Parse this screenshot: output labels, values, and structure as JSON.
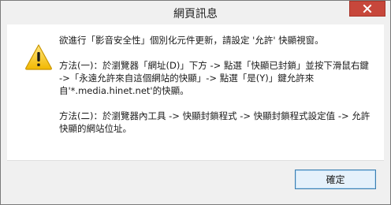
{
  "window": {
    "title": "網頁訊息",
    "close_icon": "close-icon"
  },
  "message": {
    "icon": "warning-icon",
    "line1": "欲進行「影音安全性」個別化元件更新，請設定 '允許' 快顯視窗。",
    "para2": "方法(一)：於瀏覽器「網址(D)」下方 -> 點選「快顯已封鎖」並按下滑鼠右鍵 ->「永遠允許來自這個網站的快顯」-> 點選「是(Y)」鍵允許來自'*.media.hinet.net'的快顯。",
    "para3": "方法(二)：於瀏覽器內工具 -> 快顯封鎖程式 -> 快顯封鎖程式設定值 -> 允許快顯的網站位址。"
  },
  "buttons": {
    "ok_label": "確定"
  },
  "colors": {
    "close_button": "#c7473b",
    "warning_yellow": "#f5c400",
    "ok_border": "#3c7fb1",
    "ok_fill": "#e5f1fb"
  }
}
